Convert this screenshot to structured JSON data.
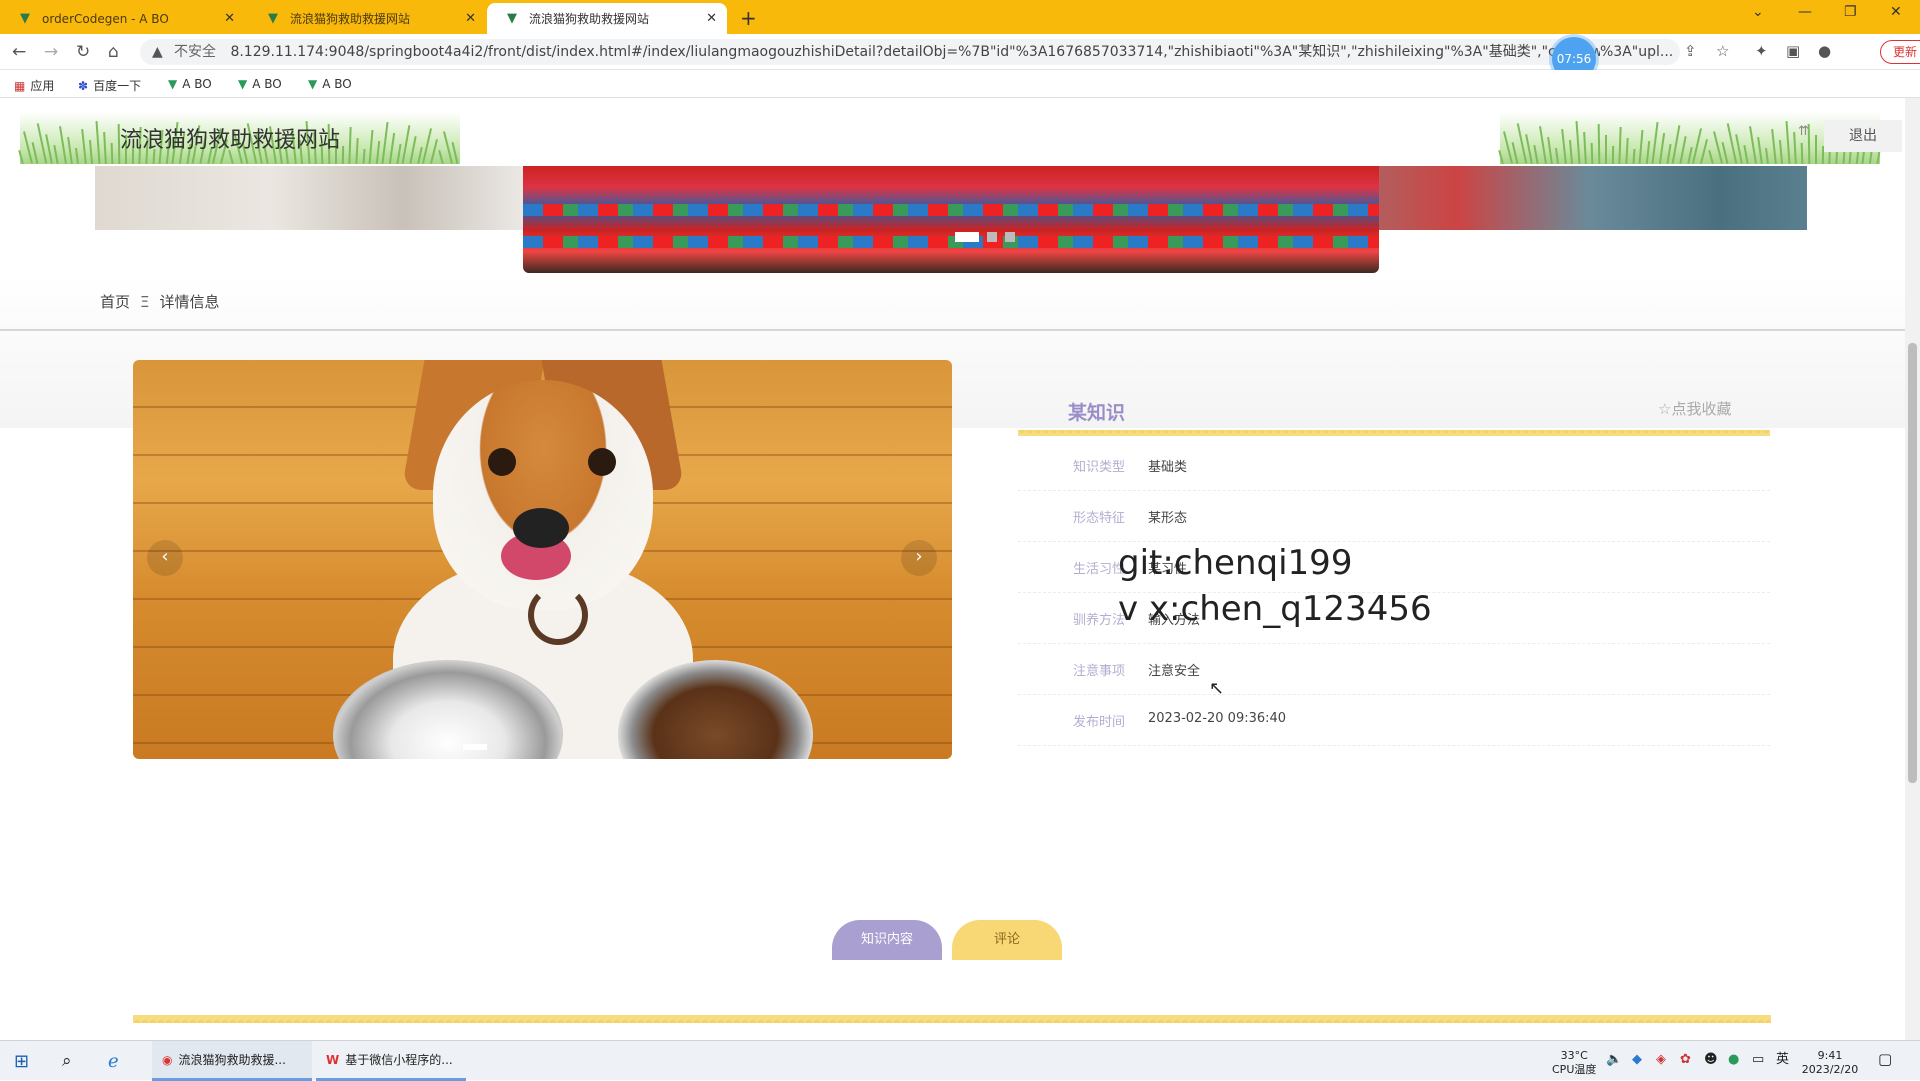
{
  "browser": {
    "tabs": [
      {
        "label": "orderCodegen - A BO",
        "icon": "vue-icon"
      },
      {
        "label": "流浪猫狗救助救援网站",
        "icon": "vue-icon"
      },
      {
        "label": "流浪猫狗救助救援网站",
        "icon": "vue-icon",
        "active": true
      }
    ],
    "url_security": "不安全",
    "url": "8.129.11.174:9048/springboot4a4i2/front/dist/index.html#/index/liulangmaogouzhishiDetail?detailObj=%7B\"id\"%3A1676857033714,\"zhishibiaoti\"%3A\"某知识\",\"zhishileixing\"%3A\"基础类\",\"chongwu",
    "url_tail": "%3A\"upl...",
    "timer": "07:56",
    "update_label": "更新",
    "bookmarks": [
      "应用",
      "百度一下",
      "A BO",
      "A BO",
      "A BO"
    ]
  },
  "site": {
    "title": "流浪猫狗救助救援网站",
    "logout": "退出",
    "breadcrumb": {
      "home": "首页",
      "separator": "Ξ",
      "current": "详情信息"
    }
  },
  "detail": {
    "title": "某知识",
    "favorite": "☆点我收藏",
    "fields": [
      {
        "label": "知识类型",
        "value": "基础类"
      },
      {
        "label": "形态特征",
        "value": "某形态"
      },
      {
        "label": "生活习性",
        "value": "某习性"
      },
      {
        "label": "驯养方法",
        "value": "输入方法"
      },
      {
        "label": "注意事项",
        "value": "注意安全"
      },
      {
        "label": "发布时间",
        "value": "2023-02-20 09:36:40"
      }
    ],
    "tabs": [
      "知识内容",
      "评论"
    ]
  },
  "watermark": {
    "line1": "git:chenqi199",
    "line2": "v x:chen_q123456"
  },
  "taskbar": {
    "apps": [
      "流浪猫狗救助救援...",
      "基于微信小程序的..."
    ],
    "cpu_temp": "33°C",
    "cpu_label": "CPU温度",
    "ime": "英",
    "time": "9:41",
    "date": "2023/2/20"
  }
}
